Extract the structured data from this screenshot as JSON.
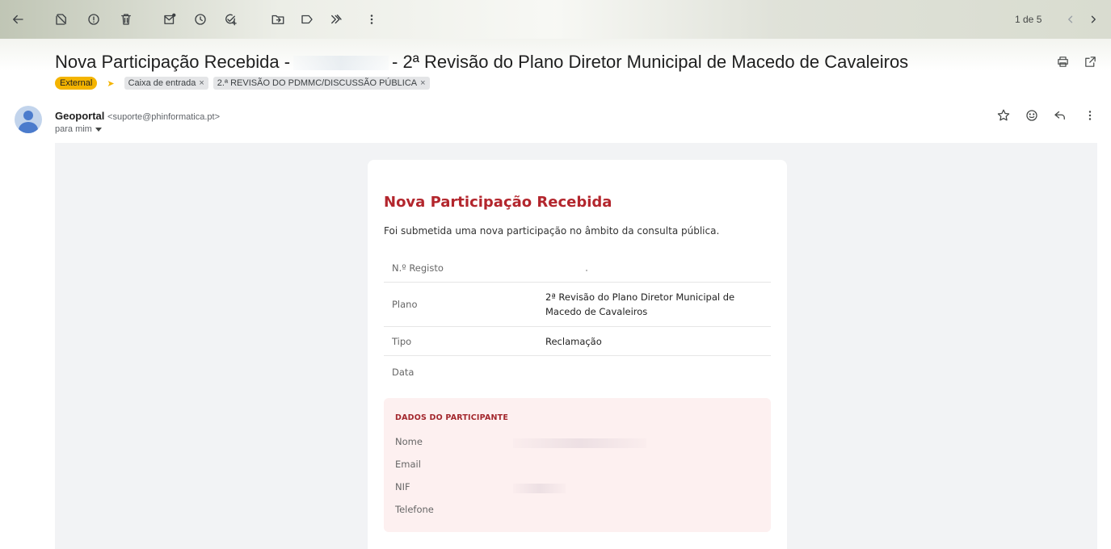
{
  "toolbar": {
    "icons": [
      "back-arrow-icon",
      "report-spam-icon",
      "report-icon",
      "delete-icon",
      "mark-unread-icon",
      "snooze-icon",
      "add-task-icon",
      "move-to-icon",
      "label-icon",
      "forward-all-icon",
      "more-icon",
      "newer-icon",
      "older-icon"
    ],
    "pager": "1 de 5"
  },
  "subject": {
    "prefix": "Nova Participação Recebida -",
    "suffix": "- 2ª Revisão do Plano Diretor Municipal de Macedo de Cavaleiros"
  },
  "labels": {
    "external": "External",
    "chips": [
      {
        "label": "Caixa de entrada",
        "remove": "×"
      },
      {
        "label": "2.ª REVISÃO DO PDMMC/DISCUSSÃO PÚBLICA",
        "remove": "×"
      }
    ]
  },
  "sender": {
    "name": "Geoportal",
    "email": "<suporte@phinformatica.pt>",
    "to": "para mim"
  },
  "card": {
    "title": "Nova Participação Recebida",
    "intro": "Foi submetida uma nova participação no âmbito da consulta pública.",
    "rows": [
      {
        "label": "N.º Registo",
        "value": ""
      },
      {
        "label": "Plano",
        "value": "2ª Revisão do Plano Diretor Municipal de Macedo de Cavaleiros"
      },
      {
        "label": "Tipo",
        "value": "Reclamação"
      },
      {
        "label": "Data",
        "value": ""
      }
    ],
    "participant": {
      "title": "DADOS DO PARTICIPANTE",
      "fields": [
        "Nome",
        "Email",
        "NIF",
        "Telefone"
      ]
    }
  },
  "colors": {
    "accent_red": "#b3262d",
    "external_chip": "#f4b400",
    "participant_bg": "#fdf0f0",
    "mail_bg": "#f2f3f5"
  }
}
